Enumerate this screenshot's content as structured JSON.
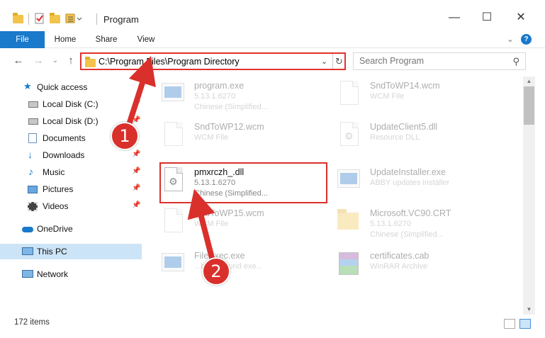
{
  "window": {
    "title": "Program",
    "minimize_glyph": "—",
    "maximize_glyph": "☐",
    "close_glyph": "✕"
  },
  "ribbon": {
    "tabs": [
      "File",
      "Home",
      "Share",
      "View"
    ],
    "expand_glyph": "⌄",
    "help_glyph": "?"
  },
  "address": {
    "path": "C:\\Program Files\\Program Directory",
    "search_placeholder": "Search Program",
    "back_glyph": "←",
    "forward_glyph": "→",
    "recent_glyph": "⌄",
    "up_glyph": "↑",
    "dropdown_glyph": "⌄",
    "refresh_glyph": "↻",
    "search_glyph": "⚲"
  },
  "nav": {
    "quick_access": "Quick access",
    "local_c": "Local Disk (C:)",
    "local_d": "Local Disk (D:)",
    "documents": "Documents",
    "downloads": "Downloads",
    "music": "Music",
    "pictures": "Pictures",
    "videos": "Videos",
    "onedrive": "OneDrive",
    "thispc": "This PC",
    "network": "Network",
    "pin_glyph": "📌"
  },
  "files": {
    "f1": {
      "name": "program.exe",
      "line2": "5.13.1.6270",
      "line3": "Chinese (Simplified..."
    },
    "f2": {
      "name": "SndToWP14.wcm",
      "line2": "WCM File"
    },
    "f3": {
      "name": "SndToWP12.wcm",
      "line2": "WCM File"
    },
    "f4": {
      "name": "UpdateClient5.dll",
      "line2": "Resource DLL"
    },
    "f5": {
      "name": "pmxrczh_.dll",
      "line2": "5.13.1.6270",
      "line3": "Chinese (Simplified..."
    },
    "f6": {
      "name": "UpdateInstaller.exe",
      "line2": "ABBY updates installer"
    },
    "f7": {
      "name": "SndToWP15.wcm",
      "line2": "WCM File"
    },
    "f8": {
      "name": "Microsoft.VC90.CRT",
      "line2": "5.13.1.6270",
      "line3": "Chinese (Simplified..."
    },
    "f9": {
      "name": "FileExec.exe",
      "line2": "...background exe..."
    },
    "f10": {
      "name": "certificates.cab",
      "line2": "WinRAR Archive"
    }
  },
  "status": {
    "items": "172 items"
  },
  "callouts": {
    "one": "1",
    "two": "2"
  },
  "colors": {
    "accent": "#1979ca",
    "highlight_red": "#d9302c",
    "selection": "#cce4f7"
  }
}
